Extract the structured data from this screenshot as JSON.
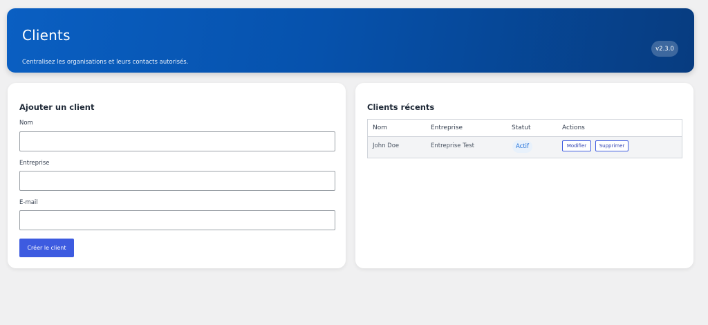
{
  "header": {
    "title": "Clients",
    "subtitle": "Centralisez les organisations et leurs contacts autorisés.",
    "version": "v2.3.0"
  },
  "form": {
    "title": "Ajouter un client",
    "fields": [
      {
        "label": "Nom",
        "value": "",
        "placeholder": ""
      },
      {
        "label": "Entreprise",
        "value": "",
        "placeholder": ""
      },
      {
        "label": "E-mail",
        "value": "",
        "placeholder": ""
      }
    ],
    "submit_label": "Créer le client"
  },
  "recent": {
    "title": "Clients récents",
    "columns": [
      "Nom",
      "Entreprise",
      "Statut",
      "Actions"
    ],
    "rows": [
      {
        "name": "John Doe",
        "company": "Entreprise Test",
        "status": "Actif",
        "actions": [
          "Modifier",
          "Supprimer"
        ]
      }
    ]
  },
  "colors": {
    "header_start": "#0a5fc2",
    "header_end": "#073c80",
    "primary_button": "#3d5be0",
    "status_badge_text": "#1e6fd9"
  }
}
